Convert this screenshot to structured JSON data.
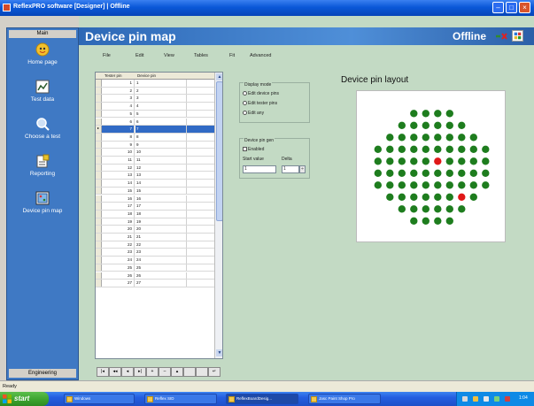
{
  "window": {
    "title": "ReflexPRO software [Designer] | Offline"
  },
  "sidebar": {
    "header": "Main",
    "footer": "Engineering",
    "items": [
      {
        "label": "Home page",
        "icon": "home-icon"
      },
      {
        "label": "Test data",
        "icon": "test-data-icon"
      },
      {
        "label": "Choose a test",
        "icon": "choose-test-icon"
      },
      {
        "label": "Reporting",
        "icon": "reporting-icon"
      },
      {
        "label": "Device pin map",
        "icon": "pin-map-icon"
      }
    ]
  },
  "header": {
    "title": "Device pin map",
    "status": "Offline"
  },
  "menu": {
    "items": [
      "File",
      "Edit",
      "View",
      "Tables",
      "Fit",
      "Advanced"
    ]
  },
  "grid": {
    "columns": [
      "Tester pin",
      "Device pin"
    ],
    "selected_index": 6,
    "rows": [
      {
        "tester": "1",
        "device": "1"
      },
      {
        "tester": "2",
        "device": "2"
      },
      {
        "tester": "3",
        "device": "3"
      },
      {
        "tester": "4",
        "device": "4"
      },
      {
        "tester": "5",
        "device": "5"
      },
      {
        "tester": "6",
        "device": "6"
      },
      {
        "tester": "7",
        "device": "7"
      },
      {
        "tester": "8",
        "device": "8"
      },
      {
        "tester": "9",
        "device": "9"
      },
      {
        "tester": "10",
        "device": "10"
      },
      {
        "tester": "11",
        "device": "11"
      },
      {
        "tester": "12",
        "device": "12"
      },
      {
        "tester": "13",
        "device": "13"
      },
      {
        "tester": "14",
        "device": "14"
      },
      {
        "tester": "15",
        "device": "15"
      },
      {
        "tester": "16",
        "device": "16"
      },
      {
        "tester": "17",
        "device": "17"
      },
      {
        "tester": "18",
        "device": "18"
      },
      {
        "tester": "19",
        "device": "19"
      },
      {
        "tester": "20",
        "device": "20"
      },
      {
        "tester": "21",
        "device": "21"
      },
      {
        "tester": "22",
        "device": "22"
      },
      {
        "tester": "23",
        "device": "23"
      },
      {
        "tester": "24",
        "device": "24"
      },
      {
        "tester": "25",
        "device": "25"
      },
      {
        "tester": "26",
        "device": "26"
      },
      {
        "tester": "27",
        "device": "27"
      }
    ],
    "nav_buttons": [
      "|◂",
      "◂◂",
      "◂",
      "▸|",
      "+",
      "–",
      "▴",
      "",
      "",
      "↵"
    ]
  },
  "display_mode": {
    "label": "Display mode",
    "options": [
      "Edit device pins",
      "Edit tester pins",
      "Edit any"
    ]
  },
  "device_pin_gen": {
    "label": "Device pin gen",
    "enabled_label": "Enabled",
    "start_value_label": "Start value",
    "delta_label": "Delta",
    "start_value": "1",
    "delta": "1"
  },
  "layout": {
    "title": "Device pin layout",
    "pin_color": "#1e7d1e",
    "highlight_color": "#e01818",
    "row_counts": [
      4,
      6,
      8,
      10,
      10,
      10,
      10,
      8,
      6,
      4
    ],
    "highlighted": [
      [
        4,
        5
      ],
      [
        7,
        6
      ]
    ]
  },
  "statusbar": {
    "text": "Ready"
  },
  "taskbar": {
    "start_label": "start",
    "tasks": [
      "Windows",
      "Reflex SID",
      "ReflexBoardDesig...",
      "Jasc Paint Shop Pro"
    ],
    "clock": "1:04"
  }
}
